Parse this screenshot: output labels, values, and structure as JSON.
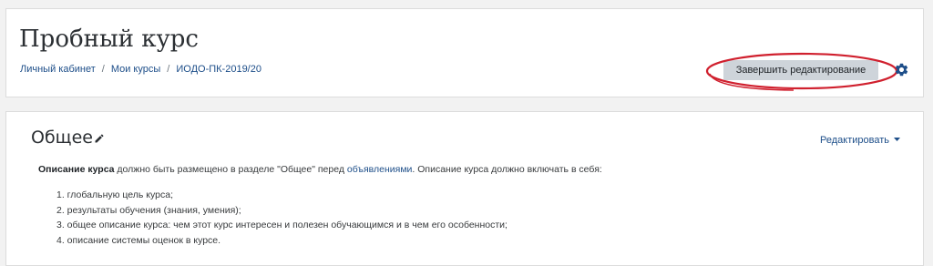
{
  "header": {
    "title": "Пробный курс",
    "breadcrumb": [
      "Личный кабинет",
      "Мои курсы",
      "ИОДО-ПК-2019/20"
    ],
    "finish_editing_label": "Завершить редактирование",
    "highlight_color": "#d0202e",
    "settings_icon": "gear-icon"
  },
  "section": {
    "title": "Общее",
    "edit_icon": "pencil-icon",
    "edit_menu_label": "Редактировать",
    "summary": {
      "bold": "Описание курса",
      "text1": " должно быть размещено в разделе \"Общее\" перед ",
      "link": "объявлениями",
      "text2": ". Описание курса должно включать в себя:"
    },
    "items": [
      "1. глобальную цель курса;",
      "2. результаты обучения (знания, умения);",
      "3. общее описание курса: чем этот курс интересен и полезен обучающимся и в чем его особенности;",
      "4. описание системы оценок в курсе."
    ]
  },
  "colors": {
    "link": "#1d4e89",
    "button_bg": "#ced4da",
    "page_bg": "#f2f2f2"
  }
}
